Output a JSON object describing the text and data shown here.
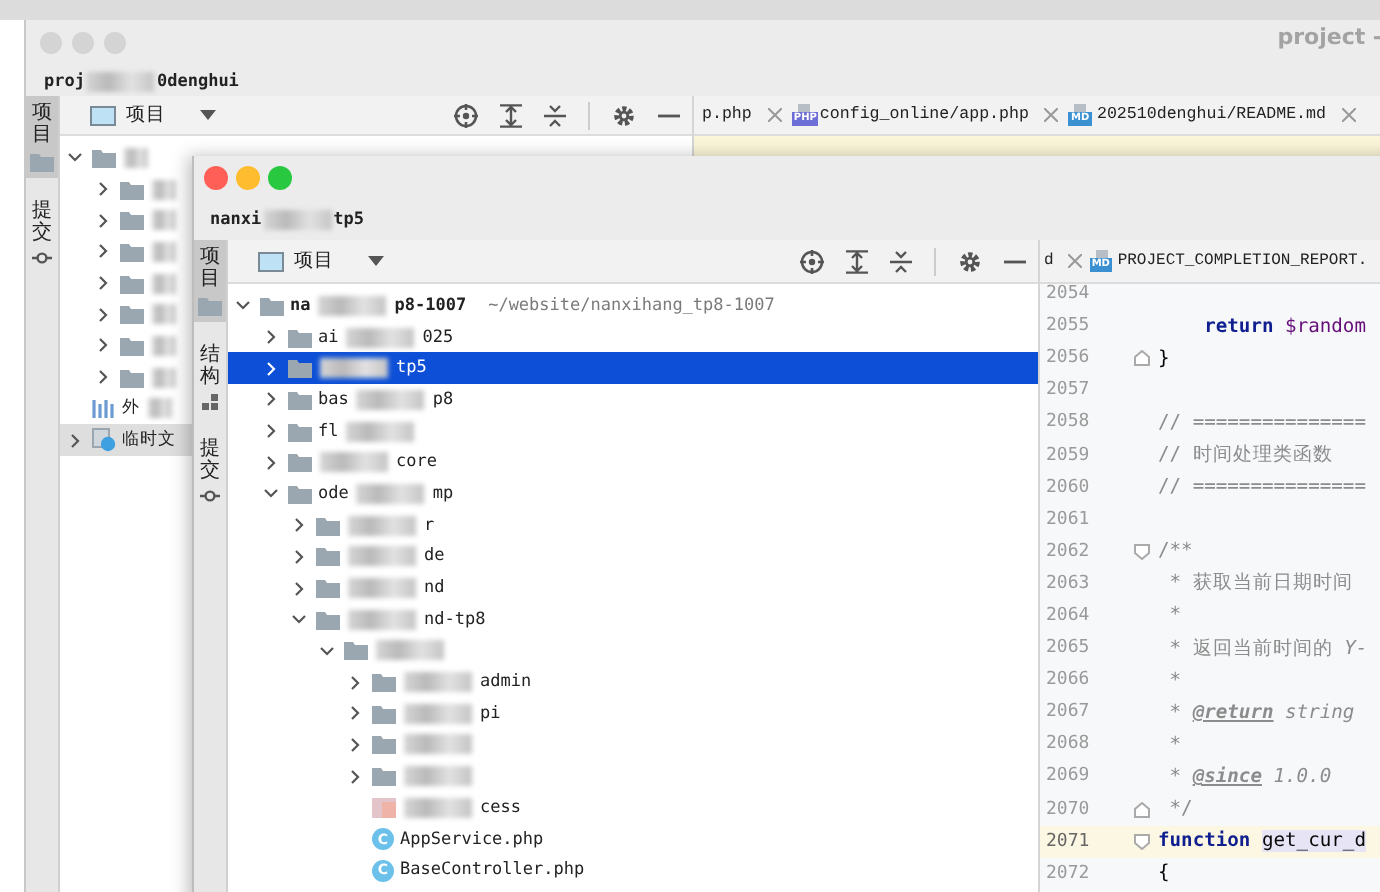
{
  "back_window": {
    "title": "project -",
    "subtitle_parts": [
      {
        "kind": "text",
        "text": "proj"
      },
      {
        "kind": "blur"
      },
      {
        "kind": "text",
        "text": "0denghui"
      }
    ],
    "side_tabs": [
      {
        "label": "项目",
        "kind": "project",
        "selected": true
      },
      {
        "label": "提交",
        "kind": "commit",
        "selected": false
      }
    ],
    "panel_title": "项目",
    "tree": [
      {
        "kind": "folder",
        "parts": [
          {
            "kind": "blur"
          }
        ],
        "expanded": true,
        "selected": false,
        "children": [
          {
            "kind": "folder",
            "parts": [
              {
                "kind": "blur"
              }
            ],
            "expanded": false,
            "selected": false
          },
          {
            "kind": "folder",
            "parts": [
              {
                "kind": "blur"
              }
            ],
            "expanded": false,
            "selected": false
          },
          {
            "kind": "folder",
            "parts": [
              {
                "kind": "blur"
              }
            ],
            "expanded": false,
            "selected": false
          },
          {
            "kind": "folder",
            "parts": [
              {
                "kind": "blur"
              }
            ],
            "expanded": false,
            "selected": false
          },
          {
            "kind": "folder",
            "parts": [
              {
                "kind": "blur"
              }
            ],
            "expanded": false,
            "selected": false
          },
          {
            "kind": "folder",
            "parts": [
              {
                "kind": "blur"
              }
            ],
            "expanded": false,
            "selected": false
          },
          {
            "kind": "folder",
            "parts": [
              {
                "kind": "blur"
              }
            ],
            "expanded": false,
            "selected": false
          }
        ]
      },
      {
        "kind": "library",
        "parts": [
          {
            "kind": "text",
            "text": "外"
          },
          {
            "kind": "blur"
          }
        ],
        "selected": false
      },
      {
        "kind": "scratch",
        "parts": [
          {
            "kind": "text",
            "text": "临时文"
          }
        ],
        "expanded": false,
        "selected": true
      }
    ],
    "editor_tabs": [
      {
        "label": "p.php",
        "kind": "plain"
      },
      {
        "label": "config_online/app.php",
        "kind": "file",
        "badge": "PHP"
      },
      {
        "label": "202510denghui/README.md",
        "kind": "file",
        "badge": "MD"
      }
    ]
  },
  "front_window": {
    "title_parts": [
      {
        "kind": "text",
        "text": "nanxi"
      },
      {
        "kind": "blur"
      },
      {
        "kind": "text",
        "text": "tp5"
      }
    ],
    "side_tabs": [
      {
        "label": "项目",
        "kind": "project",
        "selected": true
      },
      {
        "label": "结构",
        "kind": "structure",
        "selected": false
      },
      {
        "label": "提交",
        "kind": "commit",
        "selected": false
      }
    ],
    "panel_title": "项目",
    "tree": [
      {
        "kind": "folder",
        "parts": [
          {
            "kind": "text",
            "text": "na"
          },
          {
            "kind": "blur"
          },
          {
            "kind": "text",
            "text": "p8-1007"
          }
        ],
        "path": "~/website/nanxihang_tp8-1007",
        "expanded": true,
        "selected": false,
        "children": [
          {
            "kind": "folder",
            "parts": [
              {
                "kind": "text",
                "text": "ai"
              },
              {
                "kind": "blur"
              },
              {
                "kind": "text",
                "text": "025"
              }
            ],
            "expanded": false,
            "selected": false
          },
          {
            "kind": "folder",
            "parts": [
              {
                "kind": "blur"
              },
              {
                "kind": "text",
                "text": "tp5"
              }
            ],
            "expanded": false,
            "selected": true
          },
          {
            "kind": "folder",
            "parts": [
              {
                "kind": "text",
                "text": "bas"
              },
              {
                "kind": "blur"
              },
              {
                "kind": "text",
                "text": "p8"
              }
            ],
            "expanded": false,
            "selected": false
          },
          {
            "kind": "folder",
            "parts": [
              {
                "kind": "text",
                "text": "fl"
              },
              {
                "kind": "blur"
              }
            ],
            "expanded": false,
            "selected": false
          },
          {
            "kind": "folder",
            "parts": [
              {
                "kind": "blur"
              },
              {
                "kind": "text",
                "text": "core"
              }
            ],
            "expanded": false,
            "selected": false
          },
          {
            "kind": "folder",
            "parts": [
              {
                "kind": "text",
                "text": "ode"
              },
              {
                "kind": "blur"
              },
              {
                "kind": "text",
                "text": "mp"
              }
            ],
            "expanded": true,
            "selected": false,
            "children": [
              {
                "kind": "folder",
                "parts": [
                  {
                    "kind": "blur"
                  },
                  {
                    "kind": "text",
                    "text": "r"
                  }
                ],
                "expanded": false,
                "selected": false
              },
              {
                "kind": "folder",
                "parts": [
                  {
                    "kind": "blur"
                  },
                  {
                    "kind": "text",
                    "text": "de"
                  }
                ],
                "expanded": false,
                "selected": false
              },
              {
                "kind": "folder",
                "parts": [
                  {
                    "kind": "blur"
                  },
                  {
                    "kind": "text",
                    "text": "nd"
                  }
                ],
                "expanded": false,
                "selected": false
              },
              {
                "kind": "folder",
                "parts": [
                  {
                    "kind": "blur"
                  },
                  {
                    "kind": "text",
                    "text": "nd-tp8"
                  }
                ],
                "expanded": true,
                "selected": false,
                "children": [
                  {
                    "kind": "folder",
                    "parts": [
                      {
                        "kind": "blur"
                      }
                    ],
                    "expanded": true,
                    "selected": false,
                    "children": [
                      {
                        "kind": "folder",
                        "parts": [
                          {
                            "kind": "blur"
                          },
                          {
                            "kind": "text",
                            "text": "admin"
                          }
                        ],
                        "expanded": false,
                        "selected": false
                      },
                      {
                        "kind": "folder",
                        "parts": [
                          {
                            "kind": "blur"
                          },
                          {
                            "kind": "text",
                            "text": "pi"
                          }
                        ],
                        "expanded": false,
                        "selected": false
                      },
                      {
                        "kind": "folder",
                        "parts": [
                          {
                            "kind": "blur"
                          }
                        ],
                        "expanded": false,
                        "selected": false
                      },
                      {
                        "kind": "folder",
                        "parts": [
                          {
                            "kind": "blur"
                          }
                        ],
                        "expanded": false,
                        "selected": false
                      },
                      {
                        "kind": "config",
                        "parts": [
                          {
                            "kind": "blur"
                          },
                          {
                            "kind": "text",
                            "text": "cess"
                          }
                        ],
                        "selected": false
                      },
                      {
                        "kind": "class",
                        "badge": "C",
                        "parts": [
                          {
                            "kind": "text",
                            "text": "AppService.php"
                          }
                        ],
                        "selected": false
                      },
                      {
                        "kind": "class",
                        "badge": "C",
                        "parts": [
                          {
                            "kind": "text",
                            "text": "BaseController.php"
                          }
                        ],
                        "selected": false
                      }
                    ]
                  }
                ]
              }
            ]
          }
        ]
      }
    ],
    "editor_tabs": [
      {
        "label": "d",
        "kind": "plain"
      },
      {
        "label": "PROJECT_COMPLETION_REPORT.",
        "kind": "file",
        "badge": "MD"
      }
    ],
    "code_lines": [
      {
        "number": "2054",
        "fold_start": false,
        "fold_end": false
      },
      {
        "number": "2055",
        "fold_start": false,
        "fold_end": false,
        "tokens": [
          {
            "kind": "keyword",
            "text": "    return "
          },
          {
            "kind": "variable",
            "text": "$random"
          }
        ]
      },
      {
        "number": "2056",
        "fold_start": false,
        "fold_end": true,
        "tokens": [
          {
            "kind": "plain",
            "text": "}"
          }
        ]
      },
      {
        "number": "2057",
        "fold_start": false,
        "fold_end": false
      },
      {
        "number": "2058",
        "fold_start": false,
        "fold_end": false,
        "tokens": [
          {
            "kind": "comment",
            "text": "// ==============="
          }
        ]
      },
      {
        "number": "2059",
        "fold_start": false,
        "fold_end": false,
        "tokens": [
          {
            "kind": "comment",
            "text": "// 时间处理类函数"
          }
        ]
      },
      {
        "number": "2060",
        "fold_start": false,
        "fold_end": false,
        "tokens": [
          {
            "kind": "comment",
            "text": "// ==============="
          }
        ]
      },
      {
        "number": "2061",
        "fold_start": false,
        "fold_end": false
      },
      {
        "number": "2062",
        "fold_start": true,
        "fold_end": false,
        "tokens": [
          {
            "kind": "doc",
            "text": "/**"
          }
        ]
      },
      {
        "number": "2063",
        "fold_start": false,
        "fold_end": false,
        "tokens": [
          {
            "kind": "doc",
            "text": " * 获取当前日期时间"
          }
        ]
      },
      {
        "number": "2064",
        "fold_start": false,
        "fold_end": false,
        "tokens": [
          {
            "kind": "doc",
            "text": " *"
          }
        ]
      },
      {
        "number": "2065",
        "fold_start": false,
        "fold_end": false,
        "tokens": [
          {
            "kind": "doc",
            "text": " * 返回当前时间的 "
          },
          {
            "kind": "doc_italic",
            "text": "Y-"
          }
        ]
      },
      {
        "number": "2066",
        "fold_start": false,
        "fold_end": false,
        "tokens": [
          {
            "kind": "doc",
            "text": " *"
          }
        ]
      },
      {
        "number": "2067",
        "fold_start": false,
        "fold_end": false,
        "tokens": [
          {
            "kind": "doc",
            "text": " * "
          },
          {
            "kind": "doc_tag",
            "text": "@return"
          },
          {
            "kind": "doc_italic",
            "text": " string"
          }
        ]
      },
      {
        "number": "2068",
        "fold_start": false,
        "fold_end": false,
        "tokens": [
          {
            "kind": "doc",
            "text": " *"
          }
        ]
      },
      {
        "number": "2069",
        "fold_start": false,
        "fold_end": false,
        "tokens": [
          {
            "kind": "doc",
            "text": " * "
          },
          {
            "kind": "doc_tag",
            "text": "@since"
          },
          {
            "kind": "doc_italic",
            "text": " 1.0.0"
          }
        ]
      },
      {
        "number": "2070",
        "fold_start": false,
        "fold_end": true,
        "tokens": [
          {
            "kind": "doc",
            "text": " */"
          }
        ]
      },
      {
        "number": "2071",
        "current": true,
        "fold_start": true,
        "fold_end": false,
        "tokens": [
          {
            "kind": "keyword",
            "text": "function "
          },
          {
            "kind": "usage",
            "text": "get_cur_d"
          }
        ]
      },
      {
        "number": "2072",
        "fold_start": false,
        "fold_end": false,
        "tokens": [
          {
            "kind": "plain",
            "text": "{"
          }
        ]
      }
    ]
  }
}
